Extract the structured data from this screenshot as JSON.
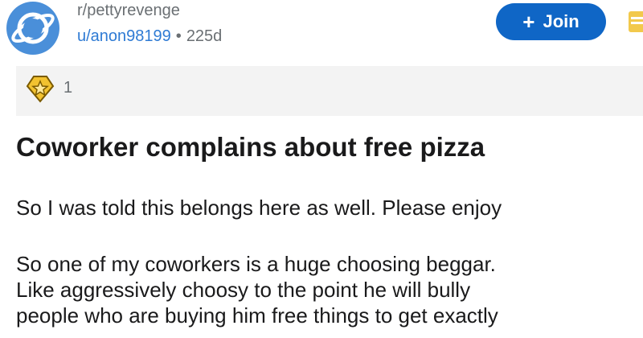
{
  "post": {
    "subreddit": "r/pettyrevenge",
    "username": "u/anon98199",
    "separator": "•",
    "age": "225d",
    "join_label": "Join",
    "award_count": "1",
    "title": "Coworker complains about free pizza",
    "paragraph1": "So I was told this belongs here as well. Please enjoy",
    "paragraph2_lines": [
      "So one of my coworkers is a huge choosing beggar.",
      "Like aggressively choosy to the point he will bully",
      "people who are buying him free things to get exactly"
    ]
  },
  "icons": {
    "avatar": "subreddit-planet-icon",
    "join": "plus-icon",
    "award": "star-award-icon",
    "menu": "menu-icon"
  },
  "colors": {
    "join_button": "#0f66c6",
    "username": "#2f7bd4",
    "avatar": "#4a8fd9",
    "award_bar": "#f3f3f3"
  }
}
